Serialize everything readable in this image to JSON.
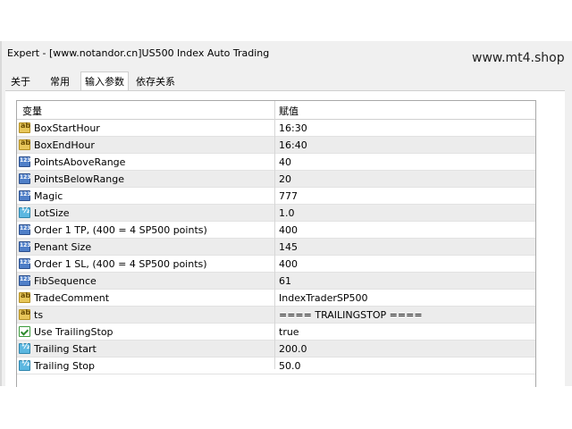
{
  "window": {
    "title": "Expert - [www.notandor.cn]US500 Index Auto Trading"
  },
  "watermark": "www.mt4.shop",
  "tabs": [
    {
      "label": "关于",
      "active": false
    },
    {
      "label": "常用",
      "active": false
    },
    {
      "label": "输入参数",
      "active": true
    },
    {
      "label": "依存关系",
      "active": false
    }
  ],
  "grid": {
    "headers": {
      "variable": "变量",
      "value": "赋值"
    },
    "rows": [
      {
        "icon": "string-ab-icon",
        "name": "BoxStartHour",
        "value": "16:30"
      },
      {
        "icon": "string-ab-icon",
        "name": "BoxEndHour",
        "value": "16:40"
      },
      {
        "icon": "integer-123-icon",
        "name": "PointsAboveRange",
        "value": "40"
      },
      {
        "icon": "integer-123-icon",
        "name": "PointsBelowRange",
        "value": "20"
      },
      {
        "icon": "integer-123-icon",
        "name": "Magic",
        "value": "777"
      },
      {
        "icon": "double-half-icon",
        "name": "LotSize",
        "value": "1.0"
      },
      {
        "icon": "integer-123-icon",
        "name": "Order 1 TP, (400 = 4 SP500 points)",
        "value": "400"
      },
      {
        "icon": "integer-123-icon",
        "name": "Penant Size",
        "value": "145"
      },
      {
        "icon": "integer-123-icon",
        "name": "Order 1 SL, (400 = 4 SP500 points)",
        "value": "400"
      },
      {
        "icon": "integer-123-icon",
        "name": "FibSequence",
        "value": "61"
      },
      {
        "icon": "string-ab-icon",
        "name": "TradeComment",
        "value": "IndexTraderSP500"
      },
      {
        "icon": "string-ab-icon",
        "name": "ts",
        "value": "==== TRAILINGSTOP ===="
      },
      {
        "icon": "bool-check-icon",
        "name": "Use TrailingStop",
        "value": "true"
      },
      {
        "icon": "double-half-icon",
        "name": "Trailing Start",
        "value": "200.0"
      },
      {
        "icon": "double-half-icon",
        "name": "Trailing Stop",
        "value": "50.0"
      }
    ]
  }
}
